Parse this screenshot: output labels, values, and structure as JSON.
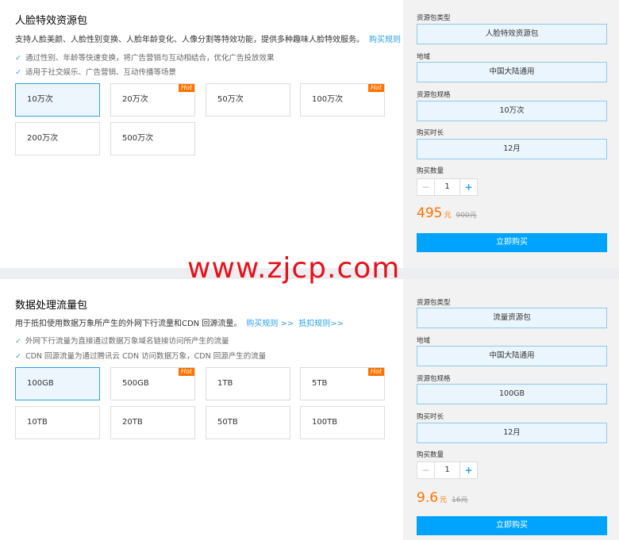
{
  "sections": [
    {
      "title": "人脸特效资源包",
      "desc": "支持人脸美颜、人脸性别变换、人脸年龄变化、人像分割等特效功能，提供多种趣味人脸特效服务。",
      "links": [
        "购买规则 >>"
      ],
      "features": [
        "通过性别、年龄等快速变换，将广告营销与互动相结合，优化广告投放效果",
        "适用于社交娱乐、广告营销、互动传播等场景"
      ],
      "options": [
        {
          "label": "10万次",
          "hot": false,
          "selected": true
        },
        {
          "label": "20万次",
          "hot": true,
          "selected": false
        },
        {
          "label": "50万次",
          "hot": false,
          "selected": false
        },
        {
          "label": "100万次",
          "hot": true,
          "selected": false
        },
        {
          "label": "200万次",
          "hot": false,
          "selected": false
        },
        {
          "label": "500万次",
          "hot": false,
          "selected": false
        }
      ],
      "form": {
        "type_label": "资源包类型",
        "type_value": "人脸特效资源包",
        "region_label": "地域",
        "region_value": "中国大陆通用",
        "spec_label": "资源包规格",
        "spec_value": "10万次",
        "duration_label": "购买时长",
        "duration_value": "12月",
        "qty_label": "购买数量",
        "qty": "1",
        "price": "495",
        "unit": "元",
        "orig_price": "900元",
        "buy_label": "立即购买"
      }
    },
    {
      "title": "数据处理流量包",
      "desc": "用于抵扣使用数据万象所产生的外网下行流量和CDN 回源流量。",
      "links": [
        "购买规则 >>",
        "抵扣规则>>"
      ],
      "features": [
        "外网下行流量为直接通过数据万象域名链接访问所产生的流量",
        "CDN 回源流量为通过腾讯云 CDN 访问数据万象，CDN 回源产生的流量"
      ],
      "options": [
        {
          "label": "100GB",
          "hot": false,
          "selected": true
        },
        {
          "label": "500GB",
          "hot": true,
          "selected": false
        },
        {
          "label": "1TB",
          "hot": false,
          "selected": false
        },
        {
          "label": "5TB",
          "hot": true,
          "selected": false
        },
        {
          "label": "10TB",
          "hot": false,
          "selected": false
        },
        {
          "label": "20TB",
          "hot": false,
          "selected": false
        },
        {
          "label": "50TB",
          "hot": false,
          "selected": false
        },
        {
          "label": "100TB",
          "hot": false,
          "selected": false
        }
      ],
      "form": {
        "type_label": "资源包类型",
        "type_value": "流量资源包",
        "region_label": "地域",
        "region_value": "中国大陆通用",
        "spec_label": "资源包规格",
        "spec_value": "100GB",
        "duration_label": "购买时长",
        "duration_value": "12月",
        "qty_label": "购买数量",
        "qty": "1",
        "price": "9.6",
        "unit": "元",
        "orig_price": "16元",
        "buy_label": "立即购买"
      }
    }
  ],
  "hot_label": "Hot",
  "icons": {
    "check": "check-icon",
    "minus": "minus-icon",
    "plus": "plus-icon"
  },
  "colors": {
    "accent": "#2ea1e8",
    "buy": "#00a4ff",
    "price": "#ff7200",
    "hot": "#ff7200",
    "watermark": "#e8101a"
  },
  "watermark": "www.zjcp.com"
}
